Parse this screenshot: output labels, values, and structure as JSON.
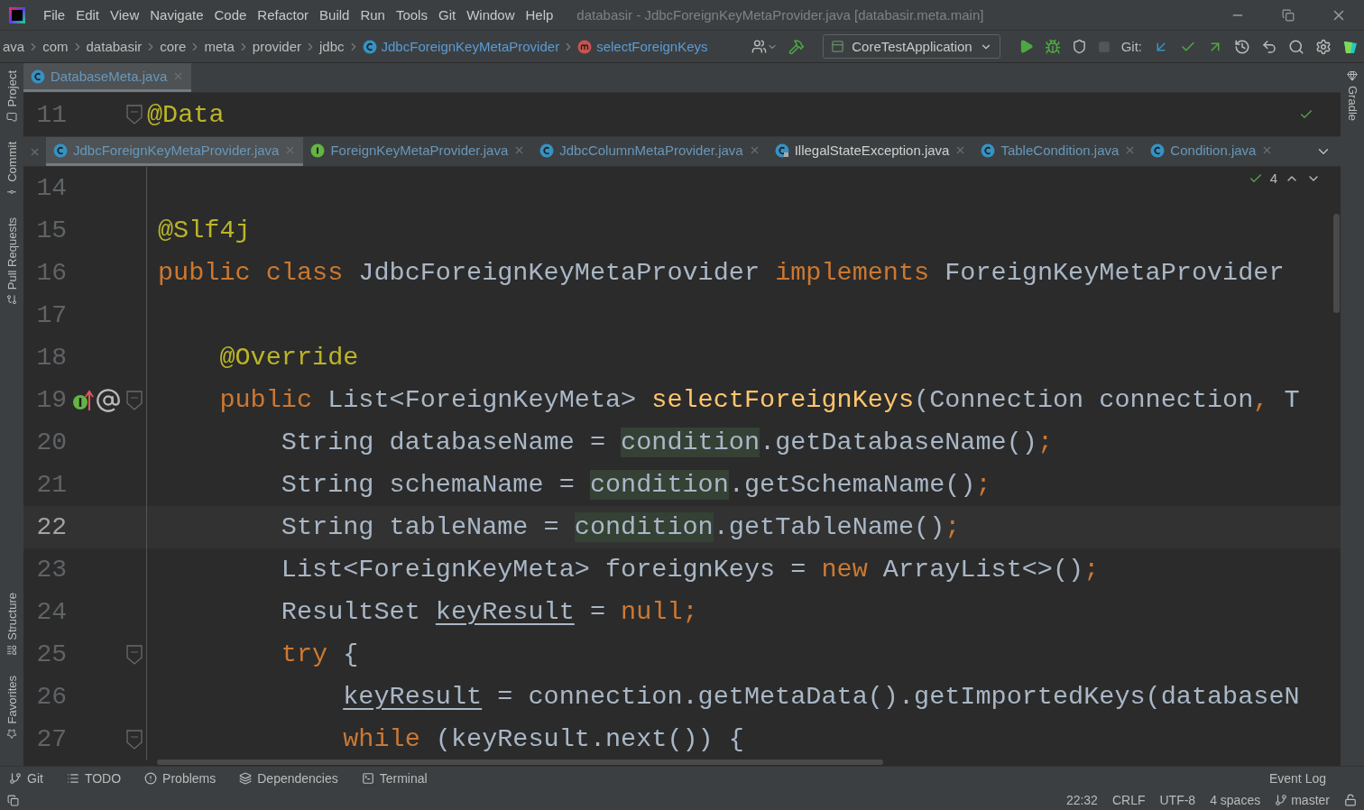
{
  "title_bar": {
    "menu": [
      "File",
      "Edit",
      "View",
      "Navigate",
      "Code",
      "Refactor",
      "Build",
      "Run",
      "Tools",
      "Git",
      "Window",
      "Help"
    ],
    "title": "databasir - JdbcForeignKeyMetaProvider.java [databasir.meta.main]"
  },
  "breadcrumb": [
    {
      "label": "ava",
      "kind": "folder"
    },
    {
      "label": "com",
      "kind": "folder"
    },
    {
      "label": "databasir",
      "kind": "folder"
    },
    {
      "label": "core",
      "kind": "folder"
    },
    {
      "label": "meta",
      "kind": "folder"
    },
    {
      "label": "provider",
      "kind": "folder"
    },
    {
      "label": "jdbc",
      "kind": "folder"
    },
    {
      "label": "JdbcForeignKeyMetaProvider",
      "kind": "class"
    },
    {
      "label": "selectForeignKeys",
      "kind": "method"
    }
  ],
  "toolbar": {
    "run_config": "CoreTestApplication",
    "git_label": "Git:"
  },
  "left_tool_tabs": [
    {
      "label": "Project",
      "kind": "folder"
    },
    {
      "label": "Commit",
      "kind": "commit"
    },
    {
      "label": "Pull Requests",
      "kind": "pull"
    },
    {
      "label": "Structure",
      "kind": "structure"
    },
    {
      "label": "Favorites",
      "kind": "star"
    }
  ],
  "right_tool_tabs": [
    {
      "label": "Gradle",
      "kind": "gradle"
    }
  ],
  "top_tabs": [
    {
      "label": "DatabaseMeta.java",
      "kind": "class",
      "selected": true
    }
  ],
  "sticky_line": {
    "number": "11",
    "tokens": [
      {
        "kind": "ann",
        "text": "@Data"
      }
    ]
  },
  "editor_tabs": [
    {
      "label": "JdbcForeignKeyMetaProvider.java",
      "kind": "class",
      "selected": true
    },
    {
      "label": "ForeignKeyMetaProvider.java",
      "kind": "interface",
      "selected": false
    },
    {
      "label": "JdbcColumnMetaProvider.java",
      "kind": "class",
      "selected": false
    },
    {
      "label": "IllegalStateException.java",
      "kind": "locked",
      "selected": false
    },
    {
      "label": "TableCondition.java",
      "kind": "class",
      "selected": false
    },
    {
      "label": "Condition.java",
      "kind": "class",
      "selected": false
    }
  ],
  "inspections": {
    "count": "4"
  },
  "code_lines": [
    {
      "number": "14",
      "current": false
    },
    {
      "number": "15",
      "current": false,
      "tokens": [
        {
          "kind": "ann",
          "text": "@Slf4j"
        }
      ]
    },
    {
      "number": "16",
      "current": false,
      "tokens": [
        {
          "kind": "kw",
          "text": "public class "
        },
        {
          "kind": "plain",
          "text": "JdbcForeignKeyMetaProvider "
        },
        {
          "kind": "kw",
          "text": "implements "
        },
        {
          "kind": "plain",
          "text": "ForeignKeyMetaProvider"
        }
      ]
    },
    {
      "number": "17",
      "current": false
    },
    {
      "number": "18",
      "current": false,
      "tokens": [
        {
          "kind": "ann",
          "text": "    @Override"
        }
      ]
    },
    {
      "number": "19",
      "current": false,
      "tokens": [
        {
          "kind": "kw",
          "text": "    public "
        },
        {
          "kind": "plain",
          "text": "List<ForeignKeyMeta> "
        },
        {
          "kind": "method",
          "text": "selectForeignKeys"
        },
        {
          "kind": "plain",
          "text": "(Connection connection"
        },
        {
          "kind": "kw",
          "text": ", "
        },
        {
          "kind": "plain",
          "text": "T"
        }
      ]
    },
    {
      "number": "20",
      "current": false,
      "tokens": [
        {
          "kind": "plain",
          "text": "        String databaseName = "
        },
        {
          "kind": "hl",
          "text": "condition"
        },
        {
          "kind": "plain",
          "text": ".getDatabaseName()"
        },
        {
          "kind": "kw",
          "text": ";"
        }
      ]
    },
    {
      "number": "21",
      "current": false,
      "tokens": [
        {
          "kind": "plain",
          "text": "        String schemaName = "
        },
        {
          "kind": "hl",
          "text": "condition"
        },
        {
          "kind": "plain",
          "text": ".getSchemaName()"
        },
        {
          "kind": "kw",
          "text": ";"
        }
      ]
    },
    {
      "number": "22",
      "current": true,
      "tokens": [
        {
          "kind": "plain",
          "text": "        String tableName = "
        },
        {
          "kind": "hl",
          "text": "condition"
        },
        {
          "kind": "plain",
          "text": ".getTableName()"
        },
        {
          "kind": "kw",
          "text": ";"
        }
      ]
    },
    {
      "number": "23",
      "current": false,
      "tokens": [
        {
          "kind": "plain",
          "text": "        List<ForeignKeyMeta> foreignKeys = "
        },
        {
          "kind": "kw",
          "text": "new "
        },
        {
          "kind": "plain",
          "text": "ArrayList<>()"
        },
        {
          "kind": "kw",
          "text": ";"
        }
      ]
    },
    {
      "number": "24",
      "current": false,
      "tokens": [
        {
          "kind": "plain",
          "text": "        ResultSet "
        },
        {
          "kind": "under",
          "text": "keyResult"
        },
        {
          "kind": "plain",
          "text": " = "
        },
        {
          "kind": "kw",
          "text": "null;"
        }
      ]
    },
    {
      "number": "25",
      "current": false,
      "tokens": [
        {
          "kind": "kw",
          "text": "        try "
        },
        {
          "kind": "plain",
          "text": "{"
        }
      ]
    },
    {
      "number": "26",
      "current": false,
      "tokens": [
        {
          "kind": "under",
          "text": "            keyResult"
        },
        {
          "kind": "plain",
          "text": " = connection.getMetaData().getImportedKeys(databaseN"
        }
      ]
    },
    {
      "number": "27",
      "current": false,
      "tokens": [
        {
          "kind": "kw",
          "text": "            while "
        },
        {
          "kind": "plain",
          "text": "(keyResult.next()) {"
        }
      ]
    }
  ],
  "bottom_tools": [
    {
      "label": "Git",
      "kind": "git"
    },
    {
      "label": "TODO",
      "kind": "list"
    },
    {
      "label": "Problems",
      "kind": "alert"
    },
    {
      "label": "Dependencies",
      "kind": "layers"
    },
    {
      "label": "Terminal",
      "kind": "terminal"
    }
  ],
  "event_log": "Event Log",
  "status_bar": [
    {
      "label": "22:32",
      "kind": "text"
    },
    {
      "label": "CRLF",
      "kind": "text"
    },
    {
      "label": "UTF-8",
      "kind": "text"
    },
    {
      "label": "4 spaces",
      "kind": "text"
    },
    {
      "label": "master",
      "kind": "branch"
    }
  ]
}
